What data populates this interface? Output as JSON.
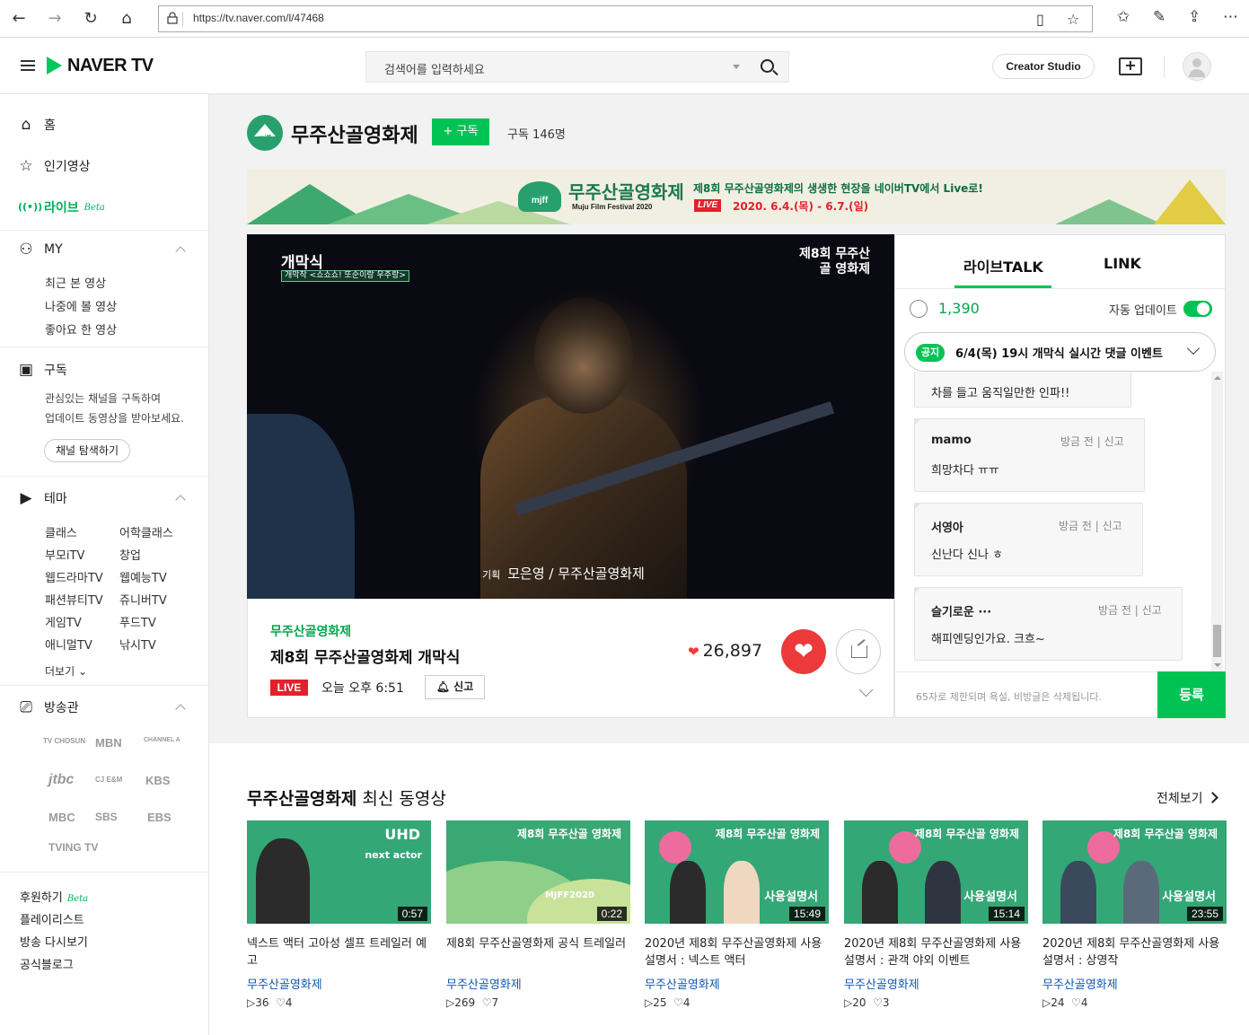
{
  "browser": {
    "url": "https://tv.naver.com/l/47468"
  },
  "header": {
    "logo_text": "NAVER TV",
    "search_placeholder": "검색어를 입력하세요",
    "creator_studio": "Creator Studio"
  },
  "sidebar": {
    "home": "홈",
    "popular": "인기영상",
    "live": "라이브",
    "live_beta": "Beta",
    "my": "MY",
    "my_items": [
      "최근 본 영상",
      "나중에 볼 영상",
      "좋아요 한 영상"
    ],
    "subscribe": "구독",
    "subscribe_desc_1": "관심있는 채널을 구독하여",
    "subscribe_desc_2": "업데이트 동영상을 받아보세요.",
    "explore_channels": "채널 탐색하기",
    "theme": "테마",
    "themes": [
      "클래스",
      "어학클래스",
      "부모iTV",
      "창업",
      "웹드라마TV",
      "웹예능TV",
      "패션뷰티TV",
      "쥬니버TV",
      "게임TV",
      "푸드TV",
      "애니멀TV",
      "낚시TV"
    ],
    "more": "더보기",
    "broadcast": "방송관",
    "broadcasters": [
      "TV CHOSUN",
      "MBN",
      "CHANNEL A",
      "jtbc",
      "CJ E&M",
      "KBS",
      "MBC",
      "SBS",
      "EBS",
      "TVING TV"
    ],
    "footer": [
      "후원하기",
      "플레이리스트",
      "방송 다시보기",
      "공식블로그"
    ],
    "footer_beta": "Beta"
  },
  "channel": {
    "name": "무주산골영화제",
    "subscribe_button": "+ 구독",
    "subscriber_count": "구독 146명"
  },
  "banner": {
    "logo": "mjff",
    "title": "무주산골영화제",
    "subtitle": "Muju Film Festival 2020",
    "line1": "제8회 무주산골영화제의 생생한 현장을 네이버TV에서 Live로!",
    "live_badge": "LIVE",
    "dates": "2020. 6.4.(목) - 6.7.(일)"
  },
  "player": {
    "overlay_title": "개막식",
    "overlay_subtitle": "개막작 <쇼쇼쇼! 또순이랑 우주랑>",
    "watermark": "제8회 무주산골 영화제",
    "credit_label": "기획",
    "credit_names": "모은영 / 무주산골영화제"
  },
  "video_info": {
    "channel": "무주산골영화제",
    "title": "제8회 무주산골영화제 개막식",
    "live_badge": "LIVE",
    "time": "오늘 오후 6:51",
    "report": "신고",
    "likes": "26,897"
  },
  "live_talk": {
    "tabs": [
      "라이브TALK",
      "LINK"
    ],
    "count": "1,390",
    "auto_update": "자동 업데이트",
    "notice_badge": "공지",
    "notice_text": "6/4(목) 19시 개막식 실시간 댓글 이벤트",
    "messages": [
      {
        "nick": "",
        "meta": "",
        "msg": "차를 들고 움직일만한 인파!!"
      },
      {
        "nick": "mamo",
        "meta": "방금 전 | 신고",
        "msg": "희망차다 ㅠㅠ"
      },
      {
        "nick": "서영아",
        "meta": "방금 전 | 신고",
        "msg": "신난다 신나 ㅎ"
      },
      {
        "nick": "슬기로운 ···",
        "meta": "방금 전 | 신고",
        "msg": "해피엔딩인가요. 크흐~"
      }
    ],
    "input_placeholder": "65자로 제한되며 욕설, 비방글은 삭제됩니다.",
    "submit": "등록"
  },
  "latest": {
    "heading_bold": "무주산골영화제",
    "heading_rest": " 최신 동영상",
    "view_all": "전체보기",
    "cards": [
      {
        "title": "넥스트 액터 고아성 셀프 트레일러 예고",
        "channel": "무주산골영화제",
        "duration": "0:57",
        "plays": "▷36",
        "likes": "♡4",
        "label": "UHD",
        "mark": "next actor"
      },
      {
        "title": "제8회 무주산골영화제 공식 트레일러",
        "channel": "무주산골영화제",
        "duration": "0:22",
        "plays": "▷269",
        "likes": "♡7",
        "label": "MJFF2020",
        "mark": "제8회 무주산골 영화제"
      },
      {
        "title": "2020년 제8회 무주산골영화제 사용설명서 : 넥스트 액터",
        "channel": "무주산골영화제",
        "duration": "15:49",
        "plays": "▷25",
        "likes": "♡4",
        "label": "사용설명서",
        "mark": "제8회 무주산골 영화제"
      },
      {
        "title": "2020년 제8회 무주산골영화제 사용설명서 : 관객 야외 이벤트",
        "channel": "무주산골영화제",
        "duration": "15:14",
        "plays": "▷20",
        "likes": "♡3",
        "label": "사용설명서",
        "mark": "제8회 무주산골 영화제"
      },
      {
        "title": "2020년 제8회 무주산골영화제 사용설명서 : 상영작",
        "channel": "무주산골영화제",
        "duration": "23:55",
        "plays": "▷24",
        "likes": "♡4",
        "label": "사용설명서",
        "mark": "제8회 무주산골 영화제"
      }
    ]
  }
}
